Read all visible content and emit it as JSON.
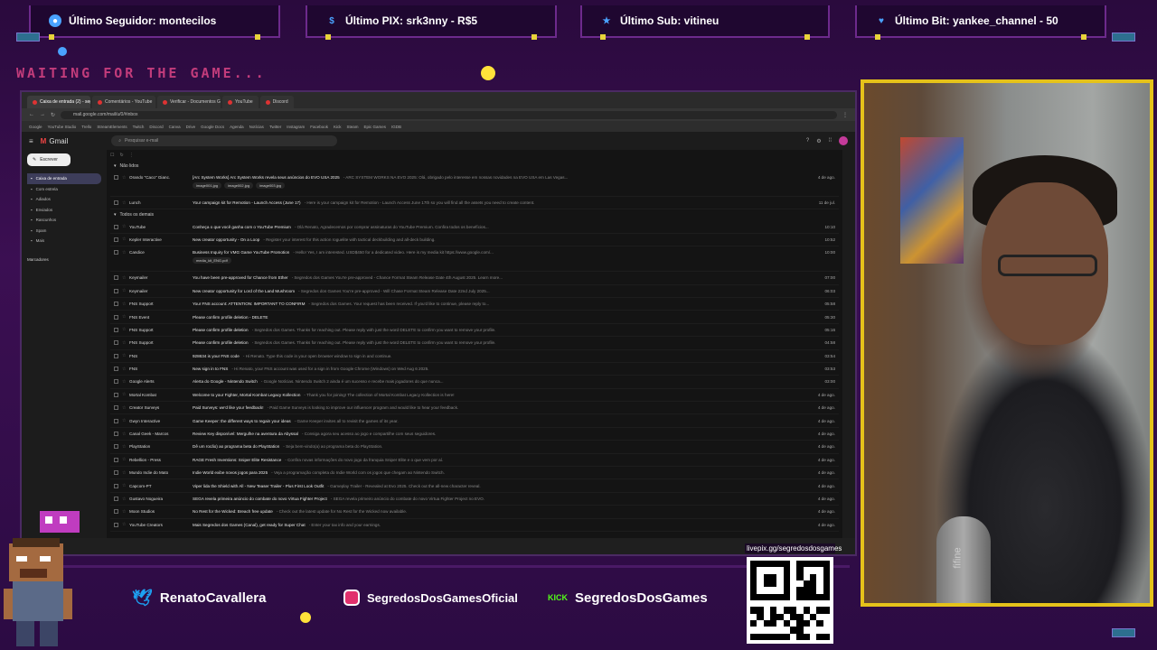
{
  "alerts": {
    "follower": {
      "label": "Último Seguidor: montecilos",
      "color": "#4aa3ff"
    },
    "pix": {
      "label": "Último PIX: srk3nny - R$5",
      "color": "#4aa3ff"
    },
    "sub": {
      "label": "Último Sub: vitineu",
      "color": "#4aa3ff"
    },
    "bit": {
      "label": "Último Bit: yankee_channel - 50",
      "color": "#4aa3ff"
    }
  },
  "waiting_text": "WAITING FOR THE GAME...",
  "browser": {
    "tabs": [
      {
        "label": "Caixa de entrada (2) - segredos",
        "active": true
      },
      {
        "label": "Comentários - YouTube",
        "active": false
      },
      {
        "label": "Verificar - Documentos Google",
        "active": false
      },
      {
        "label": "YouTube",
        "active": false
      },
      {
        "label": "Discord",
        "active": false
      }
    ],
    "url": "mail.google.com/mail/u/0/#inbox",
    "bookmarks": [
      "Google",
      "YouTube Studio",
      "Trello",
      "StreamElements",
      "Twitch",
      "Discord",
      "Canva",
      "Drive",
      "Google Docs",
      "Agenda",
      "Notícias",
      "Twitter",
      "Instagram",
      "Facebook",
      "Kick",
      "Steam",
      "Epic Games",
      "IGDB"
    ],
    "gmail": {
      "logo": "Gmail",
      "search_placeholder": "Pesquisar e-mail",
      "compose": "Escrever",
      "sidebar": [
        "Caixa de entrada",
        "Com estrela",
        "Adiados",
        "Enviados",
        "Rascunhos",
        "Spam",
        "Mais"
      ],
      "labels_title": "Marcadores",
      "unread_title": "Não lidos",
      "everything_title": "Todos os demais",
      "unread": [
        {
          "sender": "Orando \"Caco\" Gianc.",
          "subject": "[Arc System Works] Arc System Works revela seus anúncios do EVO USA 2025",
          "snippet": " - ARC SYSTEM WORKS NA EVO 2025: Olá, obrigado pelo interesse em nossas novidades na EVO USA em Las Vegas...",
          "date": "4 de ago.",
          "attachments": [
            "image001.jpg",
            "image002.jpg",
            "image003.jpg"
          ]
        },
        {
          "sender": "Lunch",
          "subject": "Your campaign kit for Remotion - Launch Access (June 17)",
          "snippet": " - Here is your campaign kit for Remotion - Launch Access June 17th so you will find all the assets you need to create content.",
          "date": "11 de jul.",
          "attachments": []
        }
      ],
      "rows": [
        {
          "sender": "YouTube",
          "subject": "Conheça o que você ganha com o YouTube Premium",
          "snippet": " - Olá Renato, Agradecemos por comprar assinaturas do YouTube Premium. Confira todos os benefícios...",
          "date": "10:10",
          "attachments": []
        },
        {
          "sender": "Kepler Interactive",
          "subject": "New creator opportunity - On a Loop",
          "snippet": " - Register your interest for this action roguelite with tactical deckbuilding and all-deck building.",
          "date": "10:52",
          "attachments": []
        },
        {
          "sender": "Candice",
          "subject": "Business Inquiry for VMG Game YouTube Promotion",
          "snippet": " - Hello! Yes, I am interested. USD$450 for a dedicated video. Here is my media kit https://www.google.com/...",
          "date": "10:00",
          "attachments": [
            "media_kit_ENG.pdf"
          ]
        },
        {
          "sender": "Keymailer",
          "subject": "You have been pre-approved for Chance from Ether",
          "snippet": " - Segredos dos Games You're pre-approved - Chance Format Steam Release Date 4th August 2025. Learn more...",
          "date": "07:00",
          "attachments": []
        },
        {
          "sender": "Keymailer",
          "subject": "New creator opportunity for Lord of the Land Mushroom",
          "snippet": " - Segredos dos Games You're pre-approved - Will Chase Format Steam Release Date 22nd July 2025...",
          "date": "06:03",
          "attachments": []
        },
        {
          "sender": "FNS Support",
          "subject": "Your FNS account: ATTENTION: IMPORTANT TO CONFIRM",
          "snippet": " - Segredos dos Games. Your request has been received. If you'd like to continue, please reply to...",
          "date": "05:58",
          "attachments": []
        },
        {
          "sender": "FNS Event",
          "subject": "Please confirm profile deletion - DELETE",
          "snippet": "",
          "date": "05:30",
          "attachments": []
        },
        {
          "sender": "FNS Support",
          "subject": "Please confirm profile deletion",
          "snippet": " - Segredos dos Games. Thanks for reaching out. Please reply with just the word DELETE to confirm you want to remove your profile.",
          "date": "05:16",
          "attachments": []
        },
        {
          "sender": "FNS Support",
          "subject": "Please confirm profile deletion",
          "snippet": " - Segredos dos Games. Thanks for reaching out. Please reply with just the word DELETE to confirm you want to remove your profile.",
          "date": "04:58",
          "attachments": []
        },
        {
          "sender": "FNS",
          "subject": "928634 is your FNS code",
          "snippet": " - Hi Renato. Type this code in your open browser window to sign in and continue.",
          "date": "03:54",
          "attachments": []
        },
        {
          "sender": "FNS",
          "subject": "New sign in to FNS",
          "snippet": " - Hi Renato, your FNS account was used for a sign in from Google Chrome (Windows) on Wed Aug 6 2025.",
          "date": "03:53",
          "attachments": []
        },
        {
          "sender": "Google Alerts",
          "subject": "Alerta do Google - Nintendo Switch",
          "snippet": " - Google Notícias. Nintendo Switch 2 ainda é um sucesso e recebe mais jogadores do que nunca...",
          "date": "03:00",
          "attachments": []
        },
        {
          "sender": "Mortal Kombat",
          "subject": "Welcome to your Fighter, Mortal Kombat Legacy Kollection",
          "snippet": " - Thank you for joining! The collection of Mortal Kombat Legacy Kollection is here!",
          "date": "4 de ago.",
          "attachments": []
        },
        {
          "sender": "Creator Surveys",
          "subject": "Paid Surveys: we'd like your feedback!",
          "snippet": " - Paid Game Surveys is looking to improve our influencer program and would like to hear your feedback.",
          "date": "4 de ago.",
          "attachments": []
        },
        {
          "sender": "Gwyn Interactive",
          "subject": "Game Keeper: the different ways to regain your ideas",
          "snippet": " - Game Keeper invites all to revisit the games of its year.",
          "date": "4 de ago.",
          "attachments": []
        },
        {
          "sender": "Canal Geek - Marcos",
          "subject": "Review Key disponível: Mergulhe na aventura da Abyssal",
          "snippet": " - Consiga agora seu acesso ao jogo e compartilhe com seus seguidores.",
          "date": "4 de ago.",
          "attachments": []
        },
        {
          "sender": "PlayStation",
          "subject": "Dê um rocão) ao programa beta do PlayStation",
          "snippet": " - Seja bem-vindo(a) ao programa beta do PlayStation.",
          "date": "4 de ago.",
          "attachments": []
        },
        {
          "sender": "Rebellion - Press",
          "subject": "RAGE Fresh Inventions: Sniper Elite Resistance",
          "snippet": " - Confira novas informações do novo jogo da franquia Sniper Elite e o que vem por aí.",
          "date": "4 de ago.",
          "attachments": []
        },
        {
          "sender": "Mundo Indie do Mato",
          "subject": "Indie World exibe novos jogos para 2025",
          "snippet": " - Veja a programação completa do Indie World com os jogos que chegam ao Nintendo Switch.",
          "date": "4 de ago.",
          "attachments": []
        },
        {
          "sender": "Capcom-PT",
          "subject": "Viper lida the Shield with All - New Teaser Trailer - Plus First Look Outfit",
          "snippet": " - Gameplay Trailer - Revealed at Evo 2025. Check out the all-new character reveal.",
          "date": "4 de ago.",
          "attachments": []
        },
        {
          "sender": "Gustavo Nogueira",
          "subject": "SEGA revela primeira anúncio do combate do novo Virtua Fighter Project",
          "snippet": " - SEGA revela primeiro anúncio do combate do novo Virtua Fighter Project no EVO.",
          "date": "4 de ago.",
          "attachments": []
        },
        {
          "sender": "Moon Studios",
          "subject": "No Rest for the Wicked: Breach free update",
          "snippet": " - Check out the latest update for No Rest for the Wicked now available.",
          "date": "4 de ago.",
          "attachments": []
        },
        {
          "sender": "YouTube Creators",
          "subject": "Mais Segredos dos Games (Canal), get ready for Super Chat",
          "snippet": " - Enter your tax info and your earnings.",
          "date": "4 de ago.",
          "attachments": []
        }
      ]
    }
  },
  "socials": [
    {
      "platform": "twitter",
      "handle": "RenatoCavallera",
      "color": "#1da1f2"
    },
    {
      "platform": "instagram",
      "handle": "SegredosDosGamesOficial",
      "color": "#e1306c"
    },
    {
      "platform": "kick",
      "handle": "SegredosDosGames",
      "color": "#53fc18",
      "badge": "KICK"
    }
  ],
  "qr": {
    "url": "livepix.gg/segredosdosgames"
  },
  "webcam": {
    "mic_brand": "fifine"
  }
}
